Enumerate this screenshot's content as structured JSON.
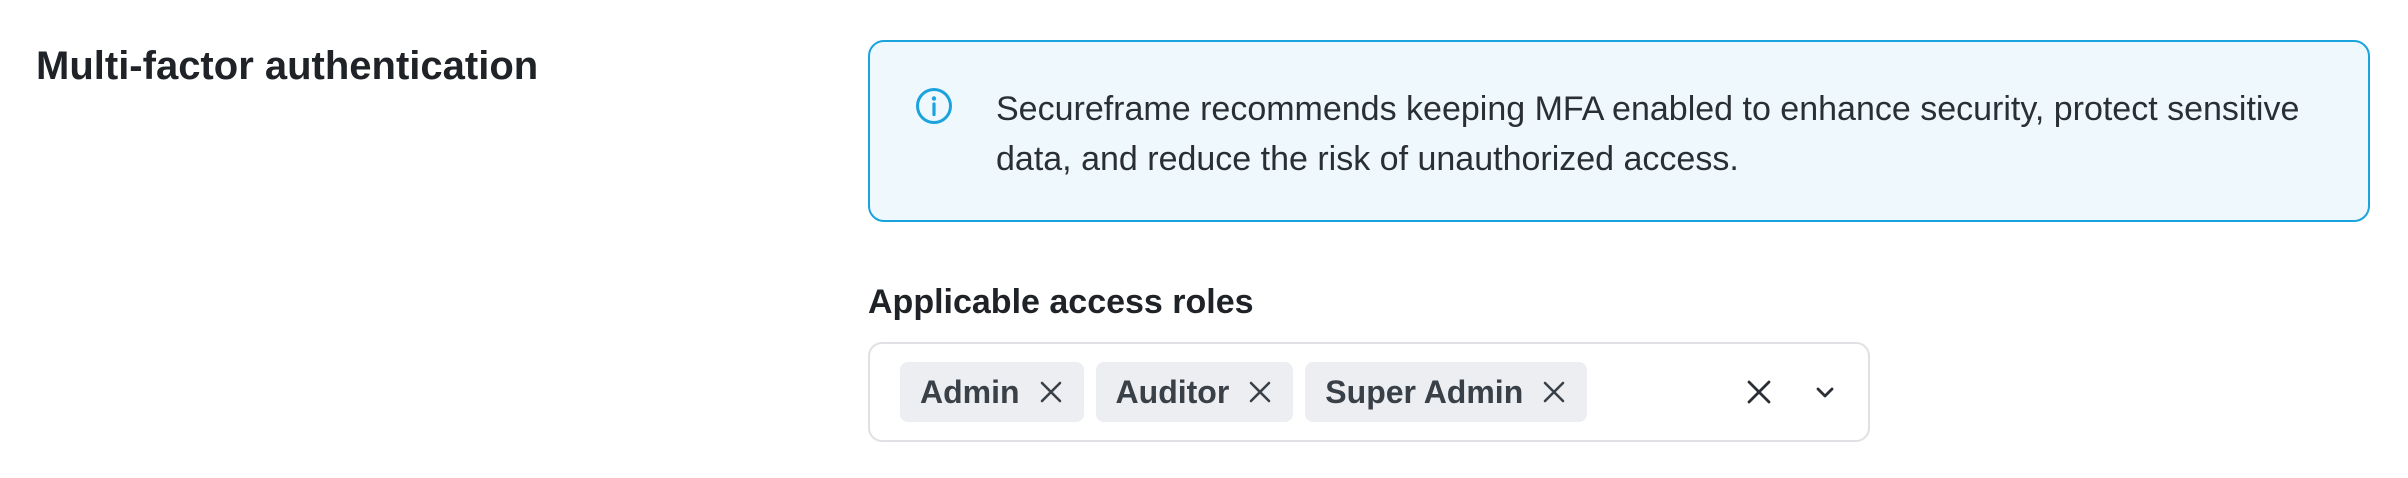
{
  "section": {
    "title": "Multi-factor authentication"
  },
  "info_banner": {
    "icon": "info-icon",
    "text": "Secureframe recommends keeping MFA enabled to enhance security, protect sensitive data, and reduce the risk of unauthorized access."
  },
  "access_roles": {
    "label": "Applicable access roles",
    "selected": [
      {
        "label": "Admin"
      },
      {
        "label": "Auditor"
      },
      {
        "label": "Super Admin"
      }
    ],
    "clear_icon": "close-icon",
    "dropdown_icon": "chevron-down-icon"
  },
  "colors": {
    "banner_border": "#1aa3dc",
    "banner_background": "#eef8fd",
    "chip_background": "#eceef1",
    "input_border": "#dfe1e5",
    "text": "#1f2328"
  }
}
